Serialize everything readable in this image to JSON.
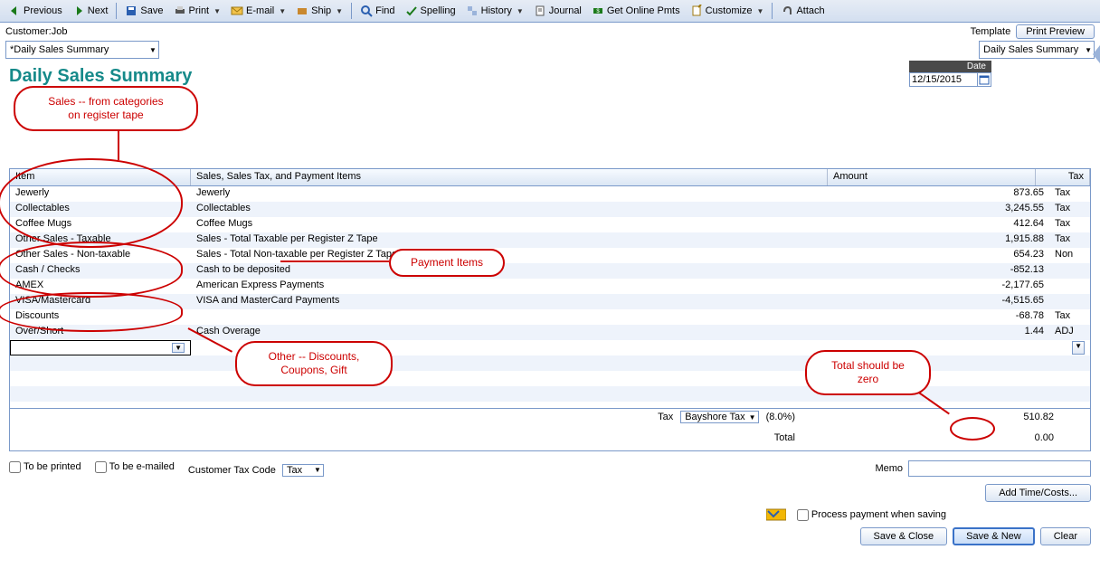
{
  "toolbar": {
    "previous": "Previous",
    "next": "Next",
    "save": "Save",
    "print": "Print",
    "email": "E-mail",
    "ship": "Ship",
    "find": "Find",
    "spelling": "Spelling",
    "history": "History",
    "journal": "Journal",
    "getonlinepmts": "Get Online Pmts",
    "customize": "Customize",
    "attach": "Attach"
  },
  "header": {
    "customerjob_label": "Customer:Job",
    "template_label": "Template",
    "print_preview": "Print Preview",
    "customer_dropdown": "*Daily Sales Summary",
    "template_dropdown": "Daily Sales Summary",
    "title": "Daily Sales Summary",
    "date_label": "Date",
    "date_value": "12/15/2015"
  },
  "columns": {
    "item": "Item",
    "desc": "Sales, Sales Tax, and Payment Items",
    "amount": "Amount",
    "tax": "Tax"
  },
  "rows": [
    {
      "item": "Jewerly",
      "desc": "Jewerly",
      "amount": "873.65",
      "tax": "Tax"
    },
    {
      "item": "Collectables",
      "desc": "Collectables",
      "amount": "3,245.55",
      "tax": "Tax"
    },
    {
      "item": "Coffee Mugs",
      "desc": "Coffee Mugs",
      "amount": "412.64",
      "tax": "Tax"
    },
    {
      "item": "Other Sales - Taxable",
      "desc": "Sales - Total Taxable per Register Z Tape",
      "amount": "1,915.88",
      "tax": "Tax"
    },
    {
      "item": "Other Sales - Non-taxable",
      "desc": "Sales - Total Non-taxable per Register Z Tape",
      "amount": "654.23",
      "tax": "Non"
    },
    {
      "item": "Cash / Checks",
      "desc": "Cash to be deposited",
      "amount": "-852.13",
      "tax": ""
    },
    {
      "item": "AMEX",
      "desc": "American Express Payments",
      "amount": "-2,177.65",
      "tax": ""
    },
    {
      "item": "VISA/Mastercard",
      "desc": "VISA and MasterCard Payments",
      "amount": "-4,515.65",
      "tax": ""
    },
    {
      "item": "Discounts",
      "desc": "",
      "amount": "-68.78",
      "tax": "Tax"
    },
    {
      "item": "Over/Short",
      "desc": "Cash Overage",
      "amount": "1.44",
      "tax": "ADJ"
    }
  ],
  "footer": {
    "tax_label": "Tax",
    "tax_item": "Bayshore Tax",
    "tax_rate": "(8.0%)",
    "tax_amount": "510.82",
    "total_label": "Total",
    "total_amount": "0.00"
  },
  "bottom": {
    "to_be_printed": "To be printed",
    "to_be_emailed": "To be e-mailed",
    "cust_tax_code_label": "Customer Tax Code",
    "cust_tax_code_value": "Tax",
    "memo_label": "Memo",
    "add_time_costs": "Add Time/Costs...",
    "process_payment": "Process  payment when saving",
    "save_close": "Save & Close",
    "save_new": "Save & New",
    "clear": "Clear"
  },
  "callouts": {
    "sales": "Sales --  from categories\non register tape",
    "payment": "Payment Items",
    "other": "Other -- Discounts,\nCoupons, Gift",
    "total": "Total should be\nzero"
  }
}
